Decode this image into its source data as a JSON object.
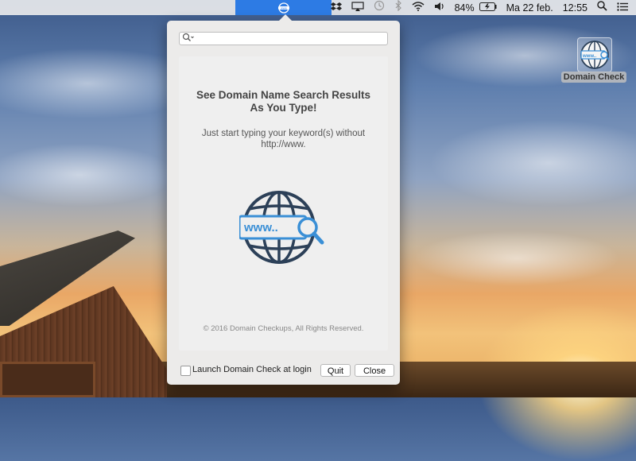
{
  "menubar": {
    "active_icon": "domain-check-globe-icon",
    "battery": "84%",
    "date": "Ma 22 feb.",
    "time": "12:55",
    "icons": [
      "dropbox-icon",
      "airplay-icon",
      "time-machine-icon",
      "bluetooth-icon",
      "wifi-icon",
      "volume-icon",
      "battery-icon",
      "spotlight-icon",
      "notification-center-icon"
    ]
  },
  "popover": {
    "search": {
      "placeholder": "",
      "value": ""
    },
    "headline_line1": "See Domain Name Search Results",
    "headline_line2": "As You Type!",
    "sub_line1": "Just start typing your keyword(s) without",
    "sub_line2": "http://www.",
    "logo_text": "www..",
    "copyright": "© 2016 Domain Checkups, All Rights Reserved.",
    "launch_label": "Launch Domain Check at login",
    "launch_checked": false,
    "quit_label": "Quit",
    "close_label": "Close"
  },
  "desktop": {
    "icon_label": "Domain Check",
    "icon_text": "www.."
  },
  "colors": {
    "accent": "#2d7be4",
    "logo_dark": "#2c4058",
    "logo_blue": "#3a8fd6"
  }
}
